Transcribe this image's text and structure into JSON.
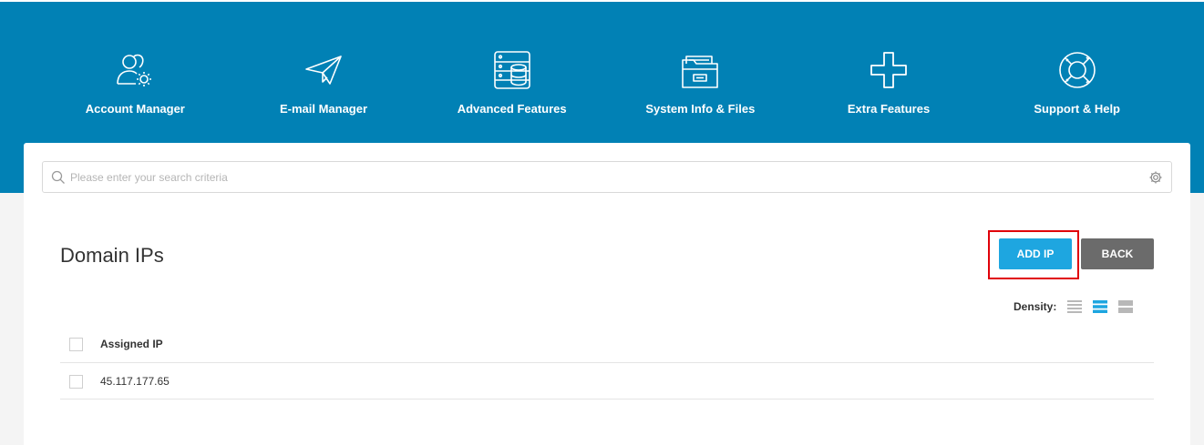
{
  "nav": {
    "items": [
      {
        "label": "Account Manager",
        "icon": "account-manager-icon"
      },
      {
        "label": "E-mail Manager",
        "icon": "paper-plane-icon"
      },
      {
        "label": "Advanced Features",
        "icon": "server-database-icon"
      },
      {
        "label": "System Info & Files",
        "icon": "folder-files-icon"
      },
      {
        "label": "Extra Features",
        "icon": "plus-icon"
      },
      {
        "label": "Support & Help",
        "icon": "lifebuoy-icon"
      }
    ]
  },
  "search": {
    "placeholder": "Please enter your search criteria",
    "value": ""
  },
  "page": {
    "title": "Domain IPs"
  },
  "actions": {
    "add_label": "ADD IP",
    "back_label": "BACK"
  },
  "density": {
    "label": "Density:",
    "options": [
      "compact",
      "normal",
      "comfortable"
    ],
    "selected": "normal"
  },
  "table": {
    "columns": [
      "Assigned IP"
    ],
    "rows": [
      [
        "45.117.177.65"
      ]
    ]
  },
  "colors": {
    "header_bg": "#0181b5",
    "primary_button": "#1ea6e0",
    "secondary_button": "#6b6b6b",
    "highlight_border": "#e0000a"
  }
}
